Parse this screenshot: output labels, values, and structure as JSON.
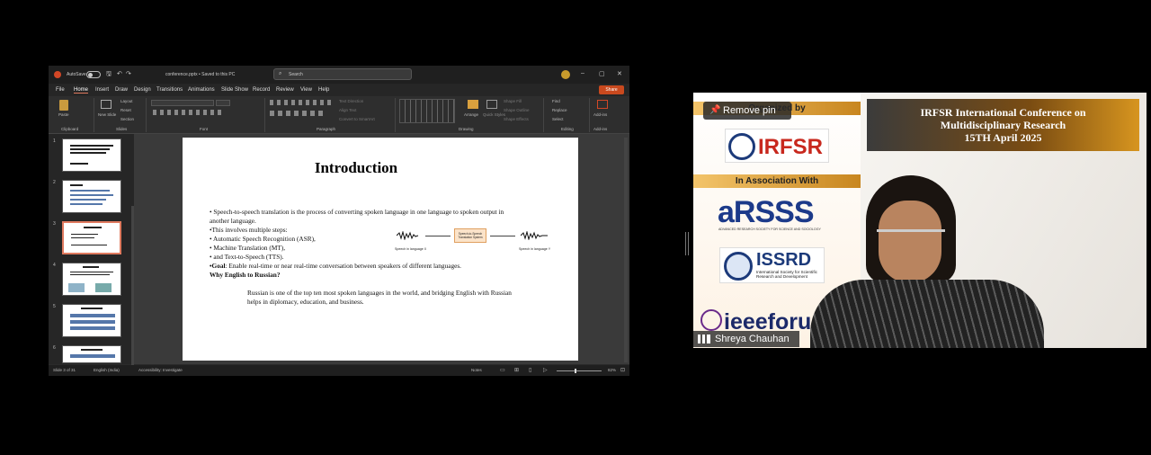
{
  "ppt": {
    "autosave_label": "AutoSave",
    "file_title": "conference.pptx • Saved to this PC",
    "search_placeholder": "Search",
    "share_label": "Share",
    "menu": [
      "File",
      "Home",
      "Insert",
      "Draw",
      "Design",
      "Transitions",
      "Animations",
      "Slide Show",
      "Record",
      "Review",
      "View",
      "Help"
    ],
    "ribbon": {
      "clipboard": "Clipboard",
      "paste": "Paste",
      "slides": "Slides",
      "new_slide": "New Slide",
      "layout": "Layout",
      "reset": "Reset",
      "section": "Section",
      "font": "Font",
      "paragraph": "Paragraph",
      "text_direction": "Text Direction",
      "align_text": "Align Text",
      "convert_smartart": "Convert to SmartArt",
      "drawing": "Drawing",
      "arrange": "Arrange",
      "quick_styles": "Quick Styles",
      "shape_fill": "Shape Fill",
      "shape_outline": "Shape Outline",
      "shape_effects": "Shape Effects",
      "find": "Find",
      "replace": "Replace",
      "select": "Select",
      "editing": "Editing",
      "addin": "Add-ins",
      "addins": "Add-ins"
    },
    "thumb_numbers": [
      "1",
      "2",
      "3",
      "4",
      "5",
      "6"
    ],
    "slide": {
      "title": "Introduction",
      "b1a": "• Speech-to-speech translation is the process of converting spoken language in one language to spoken output in",
      "b1b": "another language.",
      "b2": "•This involves multiple steps:",
      "b3": "• Automatic Speech Recognition (ASR),",
      "b4": "• Machine Translation (MT),",
      "b5": "• and Text-to-Speech (TTS).",
      "b6_bold": "•Goal",
      "b6_rest": ": Enable real-time or near real-time conversation between speakers of different languages.",
      "b7": "Why English to Russian?",
      "b8a": "Russian is one of the top ten most spoken languages in the world, and bridging English with Russian",
      "b8b": "helps in diplomacy, education, and business.",
      "diag_box": "Speech-to-Speech Translation System",
      "cap_left": "Speech in language X",
      "cap_right": "Speech in language Y"
    },
    "status": {
      "slide_of": "Slide 3 of 31",
      "language": "English (India)",
      "accessibility": "Accessibility: Investigate",
      "notes": "Notes",
      "zoom": "82%"
    }
  },
  "video": {
    "remove_pin": "Remove pin",
    "organized_by": "Organized by",
    "irfsr": "IRFSR",
    "in_assoc": "In Association With",
    "arsss": "aRSSS",
    "arsss_sub": "ADVANCED RESEARCH SOCIETY FOR SCIENCE AND SOCIOLOGY",
    "issrd": "ISSRD",
    "issrd_sub": "International Society for Scientific Research and Development",
    "ieee": "ieeeforu",
    "conf_title": "IRFSR International Conference on Multidisciplinary Research",
    "conf_date": "15TH April 2025",
    "participant": "Shreya Chauhan"
  }
}
